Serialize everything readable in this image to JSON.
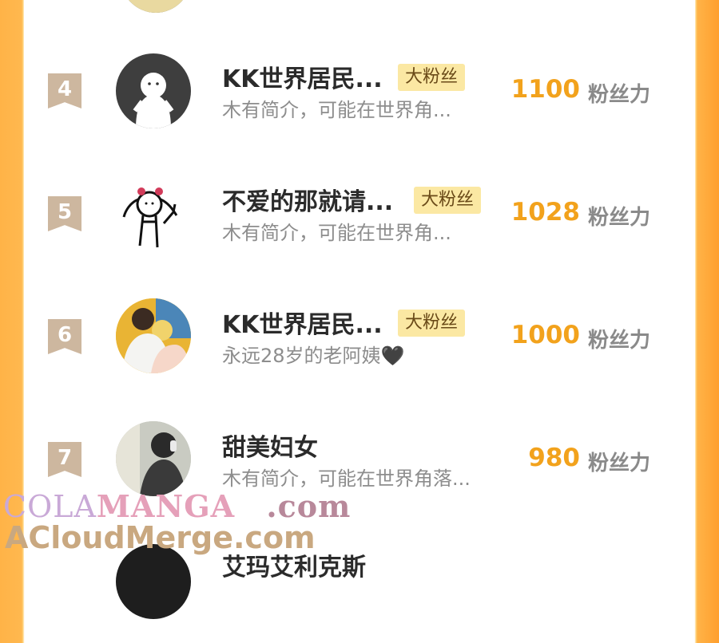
{
  "rows": [
    {
      "rank": "4",
      "name": "KK世界居民...",
      "badge": "大粉丝",
      "bio": "木有简介，可能在世界角...",
      "score": "1100",
      "unit": "粉丝力",
      "avatar_icon": "ghost-avatar-icon"
    },
    {
      "rank": "5",
      "name": "不爱的那就请...",
      "badge": "大粉丝",
      "bio": "木有简介，可能在世界角...",
      "score": "1028",
      "unit": "粉丝力",
      "avatar_icon": "doodle-girl-avatar-icon"
    },
    {
      "rank": "6",
      "name": "KK世界居民...",
      "badge": "大粉丝",
      "bio": "永远28岁的老阿姨🖤",
      "score": "1000",
      "unit": "粉丝力",
      "avatar_icon": "couple-photo-avatar"
    },
    {
      "rank": "7",
      "name": "甜美妇女",
      "badge": "",
      "bio": "木有简介，可能在世界角落...",
      "score": "980",
      "unit": "粉丝力",
      "avatar_icon": "headphones-girl-avatar"
    },
    {
      "rank": "",
      "name": "艾玛艾利克斯",
      "badge": "",
      "bio": "",
      "score": "",
      "unit": "",
      "avatar_icon": "dark-avatar-icon"
    }
  ],
  "watermark": {
    "line1_a": "COLA",
    "line1_b": "MANGA",
    "line1_c": ".com",
    "line2": "ACloudMerge.com"
  },
  "colors": {
    "frame": "#ffb347",
    "score": "#f2a21c",
    "badge_bg": "#fbe8a3",
    "rank_bg": "#cdb79f"
  }
}
